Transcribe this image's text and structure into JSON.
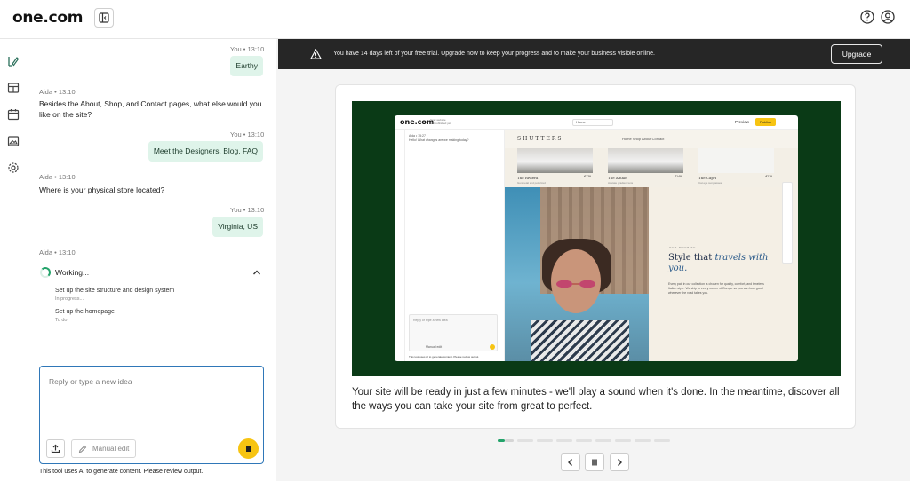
{
  "header": {
    "logo": "one.com",
    "toggle_icon": "sidebar-toggle-icon",
    "help_icon": "help-icon",
    "account_icon": "account-icon"
  },
  "rail": {
    "items": [
      {
        "icon": "edit-flow-icon"
      },
      {
        "icon": "shop-icon"
      },
      {
        "icon": "calendar-icon"
      },
      {
        "icon": "image-icon"
      },
      {
        "icon": "settings-icon"
      }
    ]
  },
  "chat": {
    "messages": [
      {
        "sender": "You",
        "time": "13:10",
        "text": "Earthy"
      },
      {
        "sender": "Aida",
        "time": "13:10",
        "text": "Besides the About, Shop, and Contact pages, what else would you like on the site?"
      },
      {
        "sender": "You",
        "time": "13:10",
        "text": "Meet the Designers, Blog, FAQ"
      },
      {
        "sender": "Aida",
        "time": "13:10",
        "text": "Where is your physical store located?"
      },
      {
        "sender": "You",
        "time": "13:10",
        "text": "Virginia, US"
      },
      {
        "sender": "Aida",
        "time": "13:10",
        "text": ""
      }
    ],
    "sep": "•",
    "working": {
      "label": "Working...",
      "steps": [
        {
          "title": "Set up the site structure and design system",
          "status": "In progress..."
        },
        {
          "title": "Set up the homepage",
          "status": "To do"
        }
      ]
    },
    "composer": {
      "placeholder": "Reply or type a new idea",
      "manual_edit": "Manual edit"
    },
    "disclaimer": "This tool uses AI to generate content. Please review output."
  },
  "banner": {
    "text": "You have 14 days left of your free trial. Upgrade now to keep your progress and to make your business visible online.",
    "upgrade": "Upgrade"
  },
  "card": {
    "text": "Your site will be ready in just a few minutes - we'll play a sound when it's done. In the meantime, discover all the ways you can take your site from great to perfect.",
    "mock": {
      "logo": "one.com",
      "sub1": "Gray website",
      "sub2": "Not published yet",
      "home": "Home",
      "preview": "Preview",
      "publish": "Publish",
      "ai_msg_1": "Aida • 15:27",
      "ai_msg_2": "Hello! What changes are we making today?",
      "composer_ph": "Reply or type a new idea",
      "manual_edit": "Manual edit",
      "disclaimer": "This tool uses AI to generate content. Please review output.",
      "brand": "SHUTTERS",
      "links": "Home   Shop   About   Contact",
      "products": [
        {
          "name": "The Riviera",
          "sub": "Gunmetal and polarized",
          "price": "€129"
        },
        {
          "name": "The Amalfi",
          "sub": "Acetate gradient lens",
          "price": "€149"
        },
        {
          "name": "The Capri",
          "sub": "Cat eye sunglasses",
          "price": "€119"
        }
      ],
      "kicker": "OUR PROMISE",
      "headline_a": "Style that ",
      "headline_b": "travels with you.",
      "body": "Every pair in our collection is chosen for quality, comfort, and timeless Italian style. We ship to every corner of Europe so you can look good wherever the road takes you."
    }
  },
  "carousel": {
    "prev_icon": "chevron-left-icon",
    "pause_icon": "pause-icon",
    "next_icon": "chevron-right-icon"
  }
}
